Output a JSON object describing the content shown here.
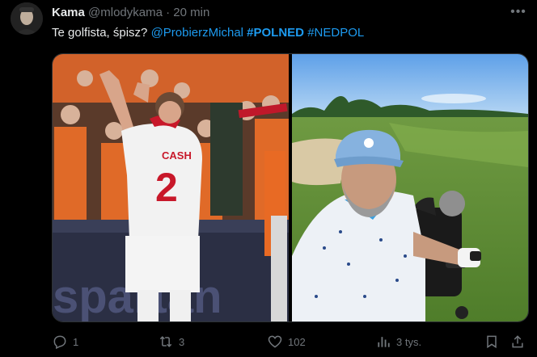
{
  "tweet": {
    "author_name": "Kama",
    "author_handle": "@mlodykama",
    "separator": "·",
    "time": "20 min",
    "more_icon": "more-horizontal-icon",
    "text": {
      "intro": "Te golfista, śpisz?",
      "mention": "@ProbierzMichal",
      "hashtag1": "#POLNED",
      "hashtag2": "#NEDPOL"
    },
    "media": {
      "left_photo": {
        "jersey_name": "CASH",
        "jersey_number": "2",
        "board_text": "spartan"
      },
      "right_photo": {}
    },
    "actions": {
      "reply_count": "1",
      "repost_count": "3",
      "like_count": "102",
      "views_count": "3 tys."
    }
  },
  "colors": {
    "background": "#000000",
    "text": "#e7e9ea",
    "muted": "#71767b",
    "link": "#1d9bf0"
  }
}
